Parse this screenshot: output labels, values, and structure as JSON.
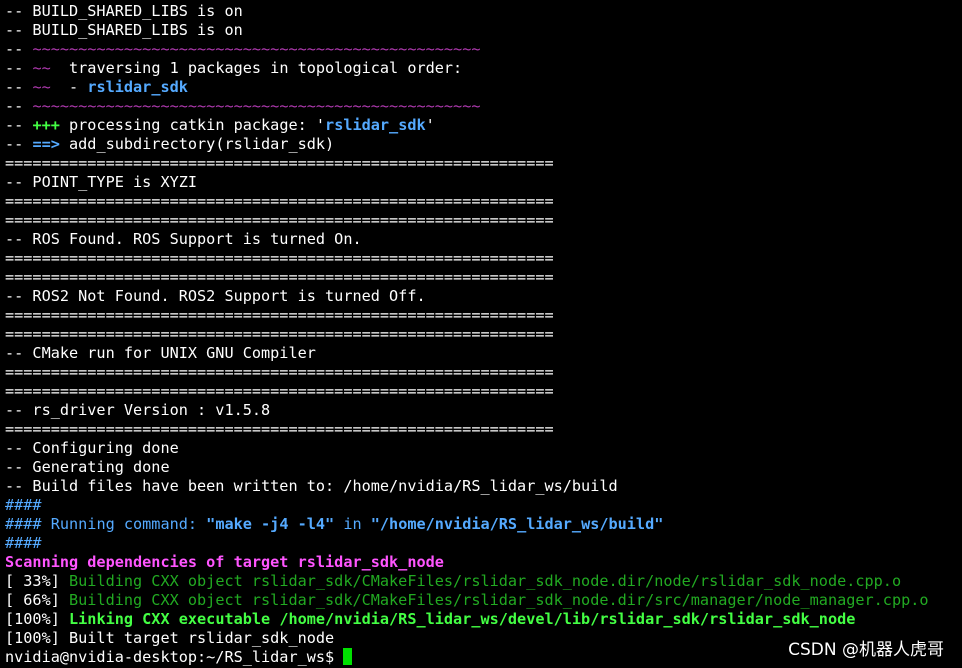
{
  "colors": {
    "background": "#000000",
    "default": "#ffffff",
    "dim_magenta": "#b03ab0",
    "blue": "#55aaff",
    "green_bold": "#44ff44",
    "magenta_bold": "#ff55ff",
    "dim_green": "#22aa22",
    "cursor": "#00e000"
  },
  "lines": [
    [
      {
        "t": "-- BUILD_SHARED_LIBS is on"
      }
    ],
    [
      {
        "t": "-- BUILD_SHARED_LIBS is on"
      }
    ],
    [
      {
        "t": "-- "
      },
      {
        "t": "~~~~~~~~~~~~~~~~~~~~~~~~~~~~~~~~~~~~~~~~~~~~~~~~~",
        "c": "dim_magenta"
      }
    ],
    [
      {
        "t": "-- "
      },
      {
        "t": "~~",
        "c": "dim_magenta"
      },
      {
        "t": "  traversing 1 packages in topological order:"
      }
    ],
    [
      {
        "t": "-- "
      },
      {
        "t": "~~",
        "c": "dim_magenta"
      },
      {
        "t": "  - "
      },
      {
        "t": "rslidar_sdk",
        "c": "blue",
        "b": true
      }
    ],
    [
      {
        "t": "-- "
      },
      {
        "t": "~~~~~~~~~~~~~~~~~~~~~~~~~~~~~~~~~~~~~~~~~~~~~~~~~",
        "c": "dim_magenta"
      }
    ],
    [
      {
        "t": "-- "
      },
      {
        "t": "+++",
        "c": "green_bold",
        "b": true
      },
      {
        "t": " processing catkin package: '"
      },
      {
        "t": "rslidar_sdk",
        "c": "blue",
        "b": true
      },
      {
        "t": "'"
      }
    ],
    [
      {
        "t": "-- "
      },
      {
        "t": "==>",
        "c": "blue",
        "b": true
      },
      {
        "t": " add_subdirectory(rslidar_sdk)"
      }
    ],
    [
      {
        "t": "============================================================"
      }
    ],
    [
      {
        "t": "-- POINT_TYPE is XYZI"
      }
    ],
    [
      {
        "t": "============================================================"
      }
    ],
    [
      {
        "t": "============================================================"
      }
    ],
    [
      {
        "t": "-- ROS Found. ROS Support is turned On."
      }
    ],
    [
      {
        "t": "============================================================"
      }
    ],
    [
      {
        "t": "============================================================"
      }
    ],
    [
      {
        "t": "-- ROS2 Not Found. ROS2 Support is turned Off."
      }
    ],
    [
      {
        "t": "============================================================"
      }
    ],
    [
      {
        "t": "============================================================"
      }
    ],
    [
      {
        "t": "-- CMake run for UNIX GNU Compiler"
      }
    ],
    [
      {
        "t": "============================================================"
      }
    ],
    [
      {
        "t": "============================================================"
      }
    ],
    [
      {
        "t": "-- rs_driver Version : v1.5.8"
      }
    ],
    [
      {
        "t": "============================================================"
      }
    ],
    [
      {
        "t": "-- Configuring done"
      }
    ],
    [
      {
        "t": "-- Generating done"
      }
    ],
    [
      {
        "t": "-- Build files have been written to: /home/nvidia/RS_lidar_ws/build"
      }
    ],
    [
      {
        "t": "####",
        "c": "blue"
      }
    ],
    [
      {
        "t": "####",
        "c": "blue"
      },
      {
        "t": " Running command: ",
        "c": "blue"
      },
      {
        "t": "\"make -j4 -l4\"",
        "c": "blue",
        "b": true
      },
      {
        "t": " in ",
        "c": "blue"
      },
      {
        "t": "\"/home/nvidia/RS_lidar_ws/build\"",
        "c": "blue",
        "b": true
      }
    ],
    [
      {
        "t": "####",
        "c": "blue"
      }
    ],
    [
      {
        "t": "Scanning dependencies of target rslidar_sdk_node",
        "c": "magenta_bold",
        "b": true
      }
    ],
    [
      {
        "t": "[ 33%] "
      },
      {
        "t": "Building CXX object rslidar_sdk/CMakeFiles/rslidar_sdk_node.dir/node/rslidar_sdk_node.cpp.o",
        "c": "dim_green"
      }
    ],
    [
      {
        "t": "[ 66%] "
      },
      {
        "t": "Building CXX object rslidar_sdk/CMakeFiles/rslidar_sdk_node.dir/src/manager/node_manager.cpp.o",
        "c": "dim_green"
      }
    ],
    [
      {
        "t": "[100%] "
      },
      {
        "t": "Linking CXX executable /home/nvidia/RS_lidar_ws/devel/lib/rslidar_sdk/rslidar_sdk_node",
        "c": "green_bold",
        "b": true
      }
    ],
    [
      {
        "t": "[100%] Built target rslidar_sdk_node"
      }
    ]
  ],
  "prompt": "nvidia@nvidia-desktop:~/RS_lidar_ws$ ",
  "watermark": "CSDN @机器人虎哥"
}
